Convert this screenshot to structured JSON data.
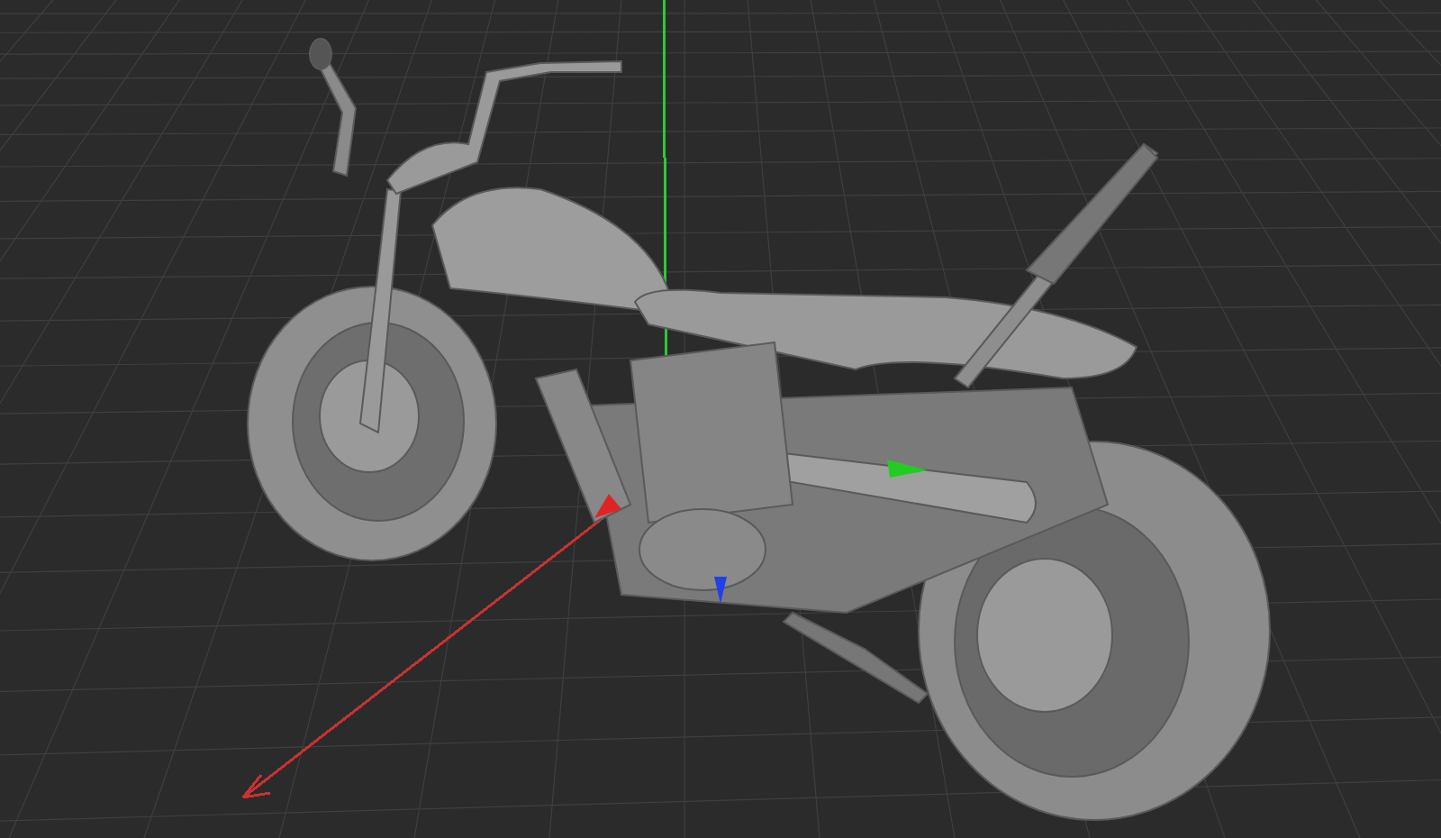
{
  "viewport": {
    "world_axes": [
      {
        "kind": "x",
        "color": "#c83232"
      },
      {
        "kind": "y",
        "color": "#2ec83a"
      }
    ],
    "gizmo_axes": [
      {
        "kind": "x",
        "color": "#e02424"
      },
      {
        "kind": "y",
        "color": "#22cc22"
      },
      {
        "kind": "z",
        "color": "#2040e8"
      }
    ]
  }
}
